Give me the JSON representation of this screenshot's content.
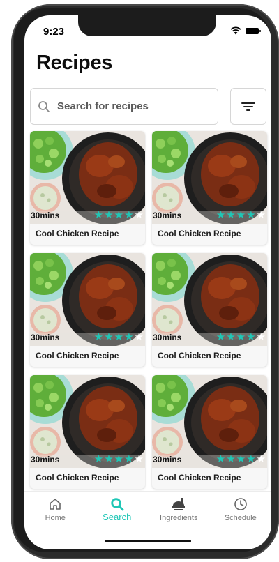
{
  "status_bar": {
    "time": "9:23"
  },
  "header": {
    "title": "Recipes"
  },
  "search": {
    "placeholder": "Search for recipes"
  },
  "recipes": [
    {
      "title": "Cool Chicken Recipe",
      "time": "30mins",
      "rating": 4
    },
    {
      "title": "Cool Chicken Recipe",
      "time": "30mins",
      "rating": 4
    },
    {
      "title": "Cool Chicken Recipe",
      "time": "30mins",
      "rating": 4
    },
    {
      "title": "Cool Chicken Recipe",
      "time": "30mins",
      "rating": 4
    },
    {
      "title": "Cool Chicken Recipe",
      "time": "30mins",
      "rating": 4
    },
    {
      "title": "Cool Chicken Recipe",
      "time": "30mins",
      "rating": 4
    }
  ],
  "tabs": [
    {
      "label": "Home",
      "icon": "home-icon",
      "active": false
    },
    {
      "label": "Search",
      "icon": "search-icon",
      "active": true
    },
    {
      "label": "Ingredients",
      "icon": "serving-dish-icon",
      "active": false
    },
    {
      "label": "Schedule",
      "icon": "clock-icon",
      "active": false
    }
  ],
  "colors": {
    "accent": "#1fc7b6",
    "text": "#0d0d0d",
    "frame": "#1c1c1c"
  }
}
